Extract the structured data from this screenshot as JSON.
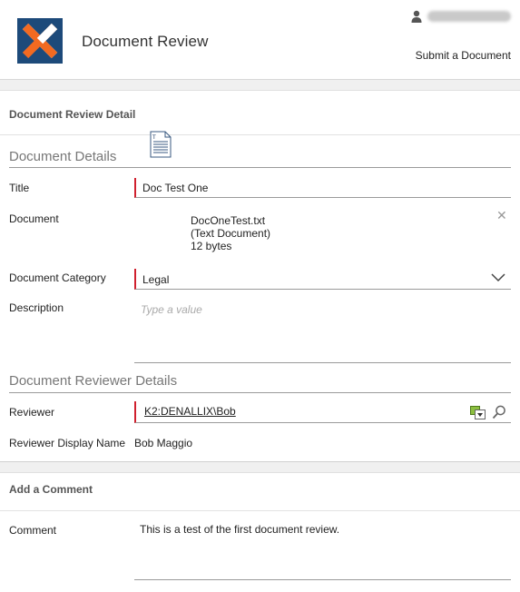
{
  "header": {
    "app_title": "Document Review",
    "submit_link": "Submit a Document",
    "brand_colors": {
      "logo_bg": "#1d4a7a",
      "logo_x_orange": "#f26a21",
      "logo_x_white": "#ffffff"
    }
  },
  "detail_panel": {
    "heading": "Document Review Detail",
    "document_details": {
      "section_title": "Document Details",
      "title_label": "Title",
      "title_value": "Doc Test One",
      "document_label": "Document",
      "document_file": {
        "name": "DocOneTest.txt",
        "type": "(Text Document)",
        "size": "12 bytes"
      },
      "category_label": "Document Category",
      "category_value": "Legal",
      "description_label": "Description",
      "description_placeholder": "Type a value"
    },
    "reviewer_details": {
      "section_title": "Document Reviewer Details",
      "reviewer_label": "Reviewer",
      "reviewer_value": "K2:DENALLIX\\Bob",
      "display_name_label": "Reviewer Display Name",
      "display_name_value": "Bob Maggio"
    }
  },
  "comment_panel": {
    "heading": "Add a Comment",
    "comment_label": "Comment",
    "comment_value": "This is a test of the first document review."
  },
  "colors": {
    "required_marker": "#d0202e",
    "field_rule": "#9a9a9a"
  }
}
